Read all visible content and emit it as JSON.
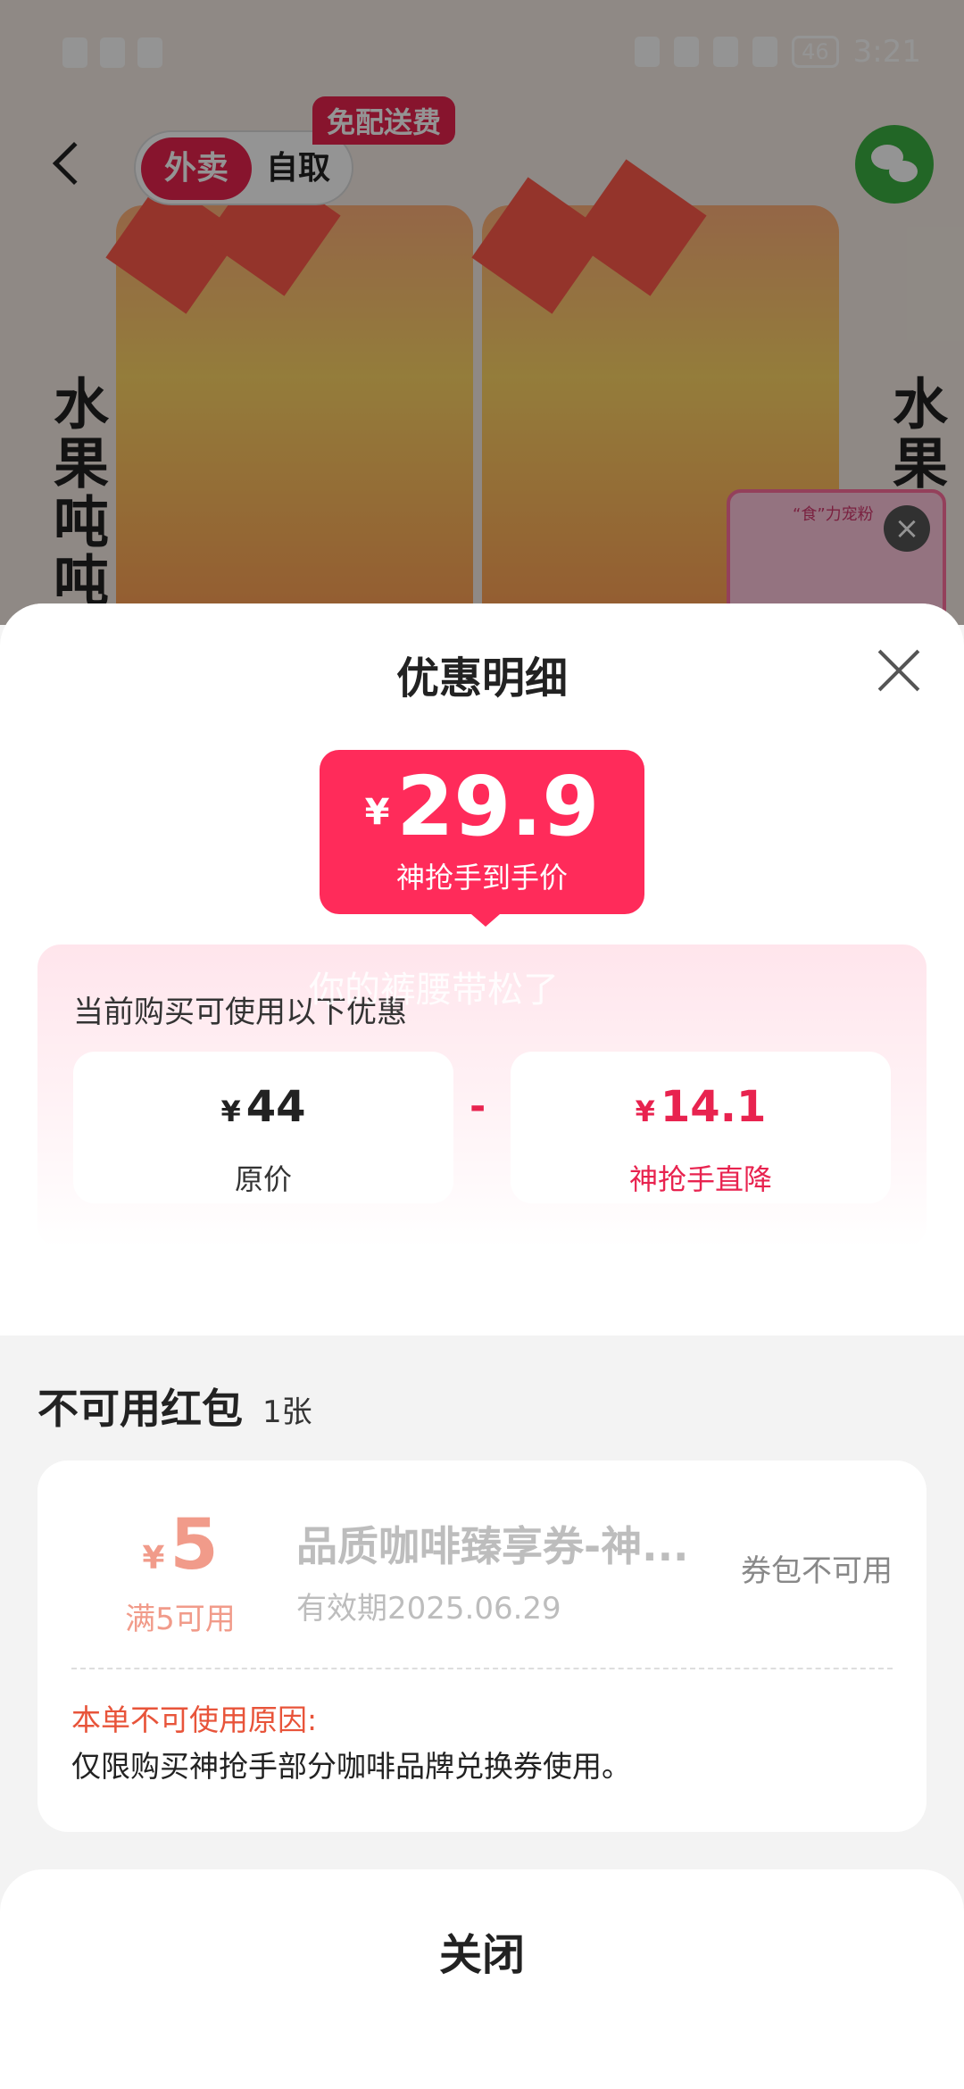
{
  "status_bar": {
    "time": "3:21",
    "battery": "46",
    "icons": [
      "alert-icon",
      "wifi-icon",
      "shield-icon",
      "alarm-icon",
      "bluetooth-icon",
      "location-icon",
      "vibrate-icon"
    ]
  },
  "background_page": {
    "mode_tabs": [
      "外卖",
      "自取"
    ],
    "free_delivery_badge": "免配送费",
    "product_text": "水果吨吨",
    "product_text_right": "水果",
    "promo_card_title": "“食”力宠粉"
  },
  "sheet": {
    "title": "优惠明细",
    "price": {
      "currency": "¥",
      "amount": "29.9",
      "label": "神抢手到手价"
    },
    "promo": {
      "title": "当前购买可使用以下优惠",
      "watermark": "你的裤腰带松了",
      "original": {
        "currency": "¥",
        "amount": "44",
        "label": "原价"
      },
      "operator": "-",
      "discount": {
        "currency": "¥",
        "amount": "14.1",
        "label": "神抢手直降"
      }
    },
    "unavailable": {
      "title": "不可用红包",
      "count": "1张",
      "coupon": {
        "currency": "¥",
        "amount": "5",
        "condition": "满5可用",
        "name": "品质咖啡臻享券-神...",
        "expiry": "有效期2025.06.29",
        "status": "券包不可用",
        "reason_title": "本单不可使用原因:",
        "reason": "仅限购买神抢手部分咖啡品牌兑换券使用。"
      }
    },
    "close_label": "关闭"
  },
  "colors": {
    "accent": "#ff2b5a",
    "coupon_disabled": "#f19b8a",
    "reason_title": "#e8543a"
  }
}
